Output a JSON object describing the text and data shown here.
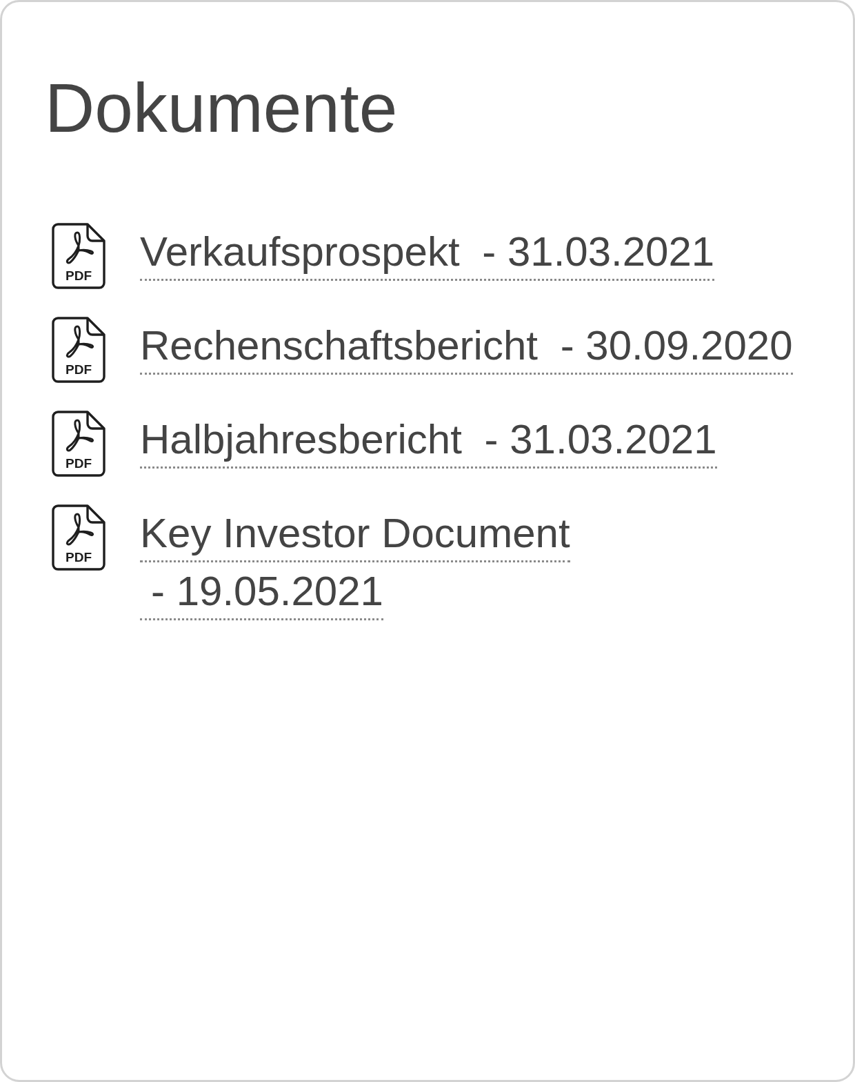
{
  "panel": {
    "title": "Dokumente"
  },
  "documents": [
    {
      "file_type": "PDF",
      "title": "Verkaufsprospekt",
      "date": "- 31.03.2021"
    },
    {
      "file_type": "PDF",
      "title": "Rechenschaftsbericht",
      "date": "- 30.09.2020"
    },
    {
      "file_type": "PDF",
      "title": "Halbjahresbericht",
      "date": "- 31.03.2021"
    },
    {
      "file_type": "PDF",
      "title": "Key Investor Document",
      "date": "- 19.05.2021"
    }
  ]
}
